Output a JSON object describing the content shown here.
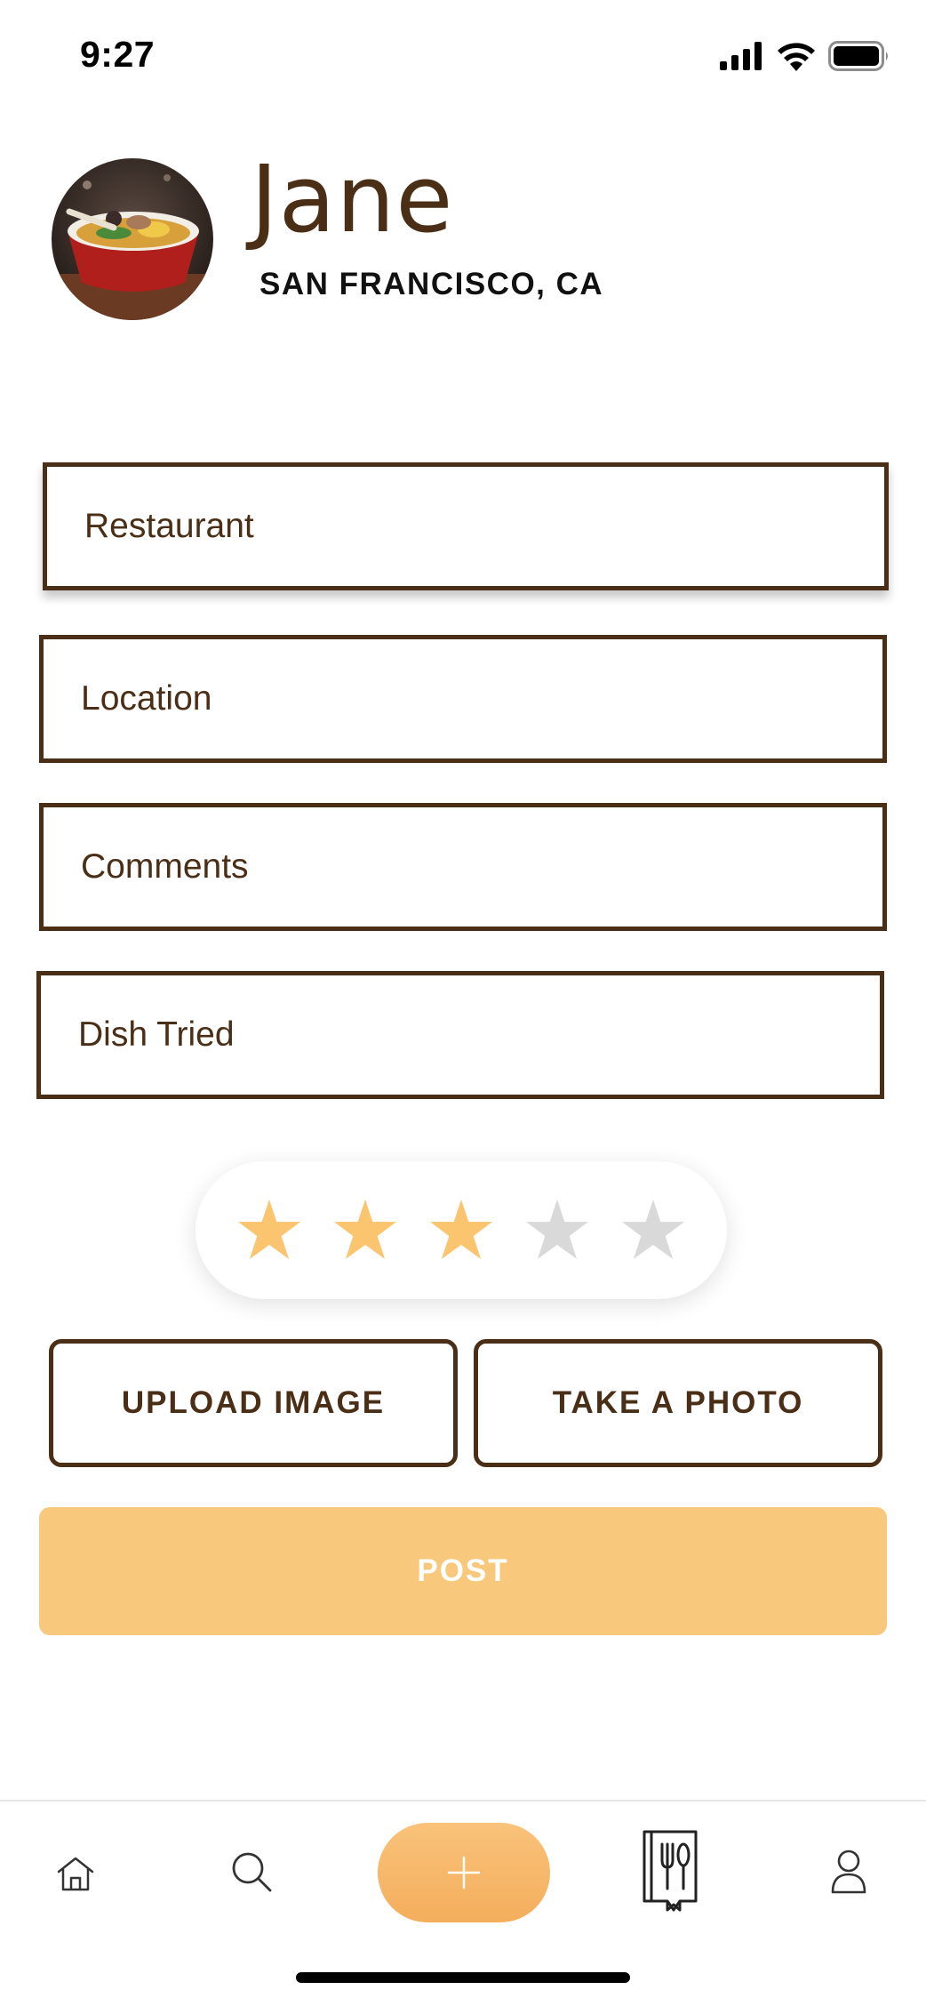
{
  "status_bar": {
    "time": "9:27"
  },
  "profile": {
    "name": "Jane",
    "location": "SAN FRANCISCO, CA",
    "avatar_icon": "ramen-bowl-photo"
  },
  "form": {
    "restaurant_placeholder": "Restaurant",
    "location_placeholder": "Location",
    "comments_placeholder": "Comments",
    "dish_placeholder": "Dish Tried"
  },
  "rating": {
    "value": 3,
    "max": 5,
    "filled_color": "#fbc46e",
    "empty_color": "#d9d9d9"
  },
  "actions": {
    "upload_label": "UPLOAD IMAGE",
    "photo_label": "TAKE A PHOTO",
    "post_label": "POST"
  },
  "nav": {
    "items": [
      "home-icon",
      "search-icon",
      "add-icon",
      "recipe-book-icon",
      "profile-icon"
    ]
  },
  "colors": {
    "brand_brown": "#4a2e16",
    "accent_orange": "#f8c87c"
  }
}
